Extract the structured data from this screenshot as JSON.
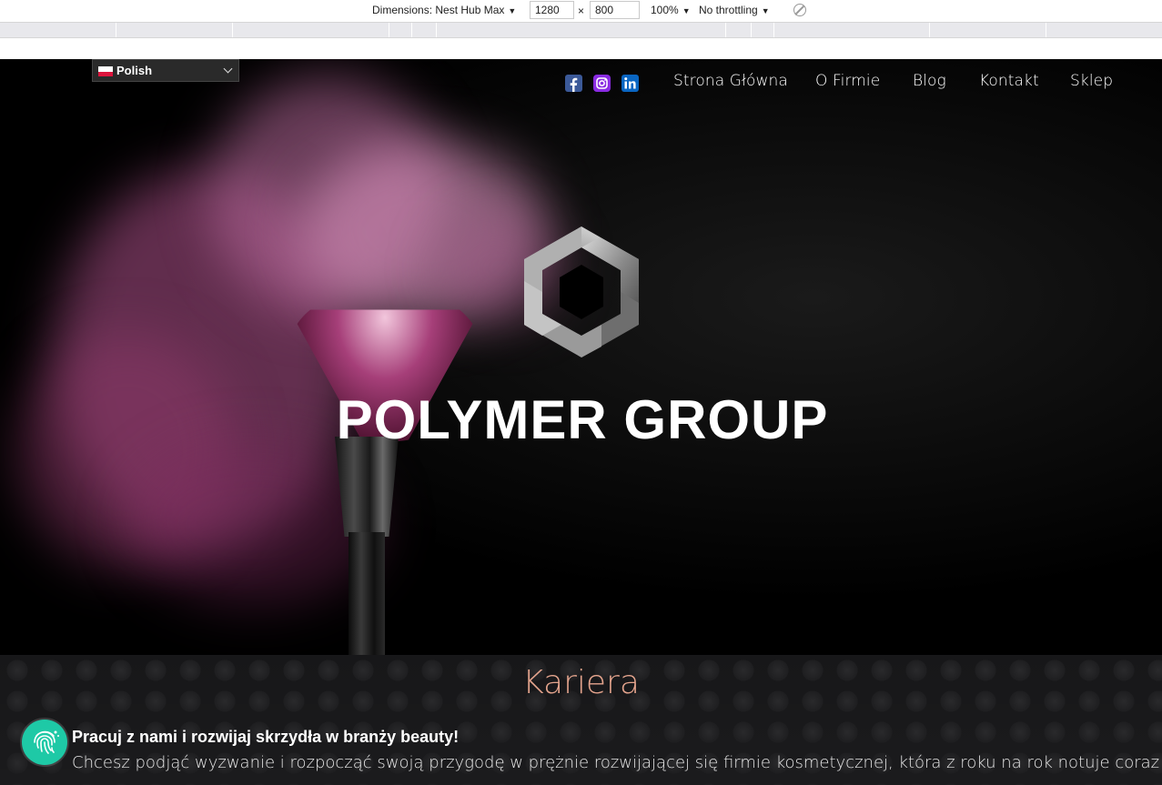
{
  "devtools": {
    "dimensions_label": "Dimensions: Nest Hub Max",
    "width": "1280",
    "times": "×",
    "height": "800",
    "zoom": "100%",
    "throttling": "No throttling"
  },
  "header": {
    "language": "Polish",
    "social": [
      "facebook-icon",
      "instagram-icon",
      "linkedin-icon"
    ],
    "nav": [
      "Strona Główna",
      "O Firmie",
      "Blog",
      "Kontakt",
      "Sklep"
    ]
  },
  "hero": {
    "brand": "POLYMER GROUP"
  },
  "career": {
    "title": "Kariera",
    "lead": "Pracuj z nami i rozwijaj skrzydła w branży beauty!",
    "body": "Chcesz podjąć wyzwanie i rozpocząć swoją przygodę w prężnie rozwijającej się firmie kosmetycznej, która z roku na rok notuje coraz"
  },
  "colors": {
    "accent_title": "#e4a48d",
    "fab": "#1ec9a6",
    "facebook": "#3b5998",
    "instagram": "#8a2be2",
    "linkedin": "#0a66c2"
  }
}
